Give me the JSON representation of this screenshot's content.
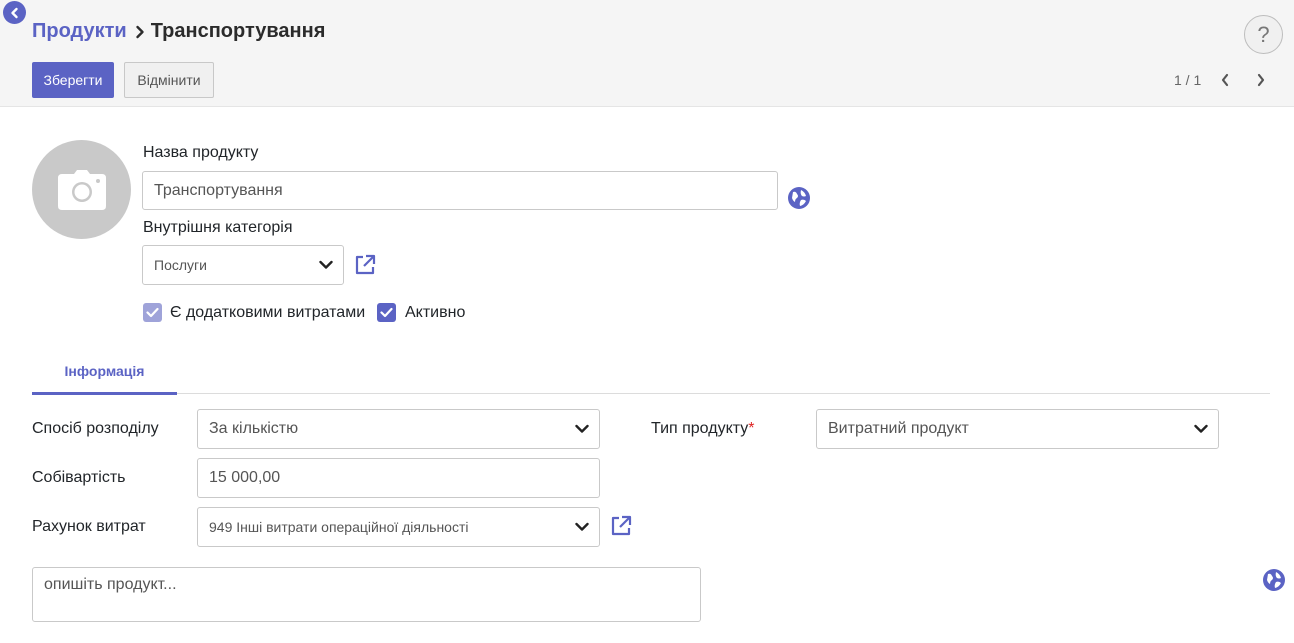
{
  "breadcrumb": {
    "parent": "Продукти",
    "current": "Транспортування"
  },
  "toolbar": {
    "save_label": "Зберегти",
    "discard_label": "Відмінити",
    "pager": "1 / 1"
  },
  "help": {
    "label": "?"
  },
  "product": {
    "name_label": "Назва продукту",
    "name_value": "Транспортування",
    "category_label": "Внутрішня категорія",
    "category_value": "Послуги",
    "checkbox_landed_cost_label": "Є додатковими витратами",
    "checkbox_landed_cost_checked": true,
    "checkbox_active_label": "Активно",
    "checkbox_active_checked": true
  },
  "tabs": [
    {
      "label": "Інформація",
      "active": true
    }
  ],
  "info": {
    "split_method_label": "Спосіб розподілу",
    "split_method_value": "За кількістю",
    "product_type_label": "Тип продукту",
    "product_type_required": "*",
    "product_type_value": "Витратний продукт",
    "cost_label": "Собівартість",
    "cost_value": "15 000,00",
    "expense_account_label": "Рахунок витрат",
    "expense_account_value": "949 Інші витрати операційної діяльності",
    "description_placeholder": "опишіть продукт..."
  },
  "colors": {
    "accent": "#5b63c4",
    "accent_light": "#9fa3d9",
    "required": "#dd2222"
  },
  "icons": [
    "back-icon",
    "chevron-right-icon",
    "help-icon",
    "camera-icon",
    "globe-icon",
    "external-link-icon",
    "chevron-down-icon",
    "check-icon",
    "chevron-left-icon"
  ]
}
